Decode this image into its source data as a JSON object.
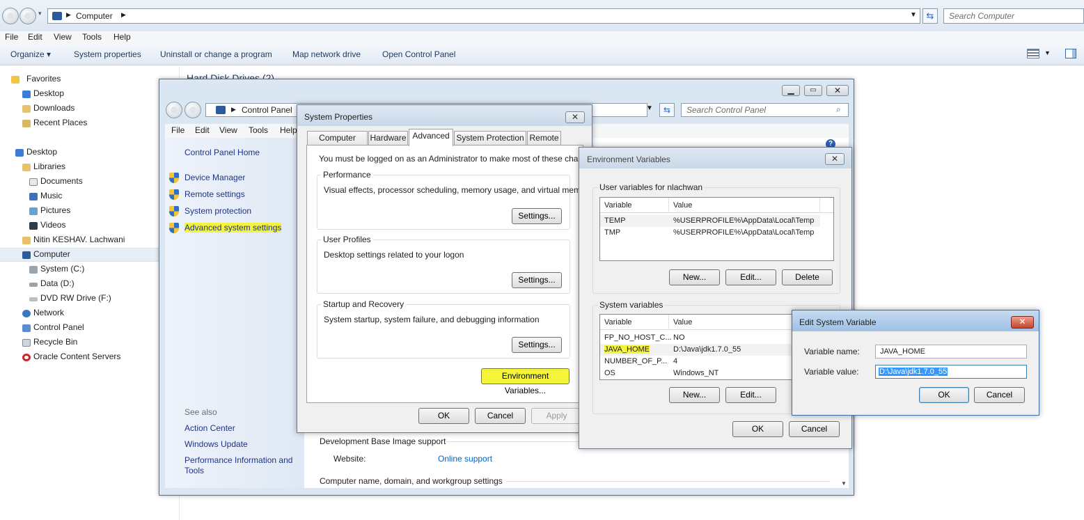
{
  "explorer": {
    "address": "Computer",
    "search_placeholder": "Search Computer",
    "menu": [
      "File",
      "Edit",
      "View",
      "Tools",
      "Help"
    ],
    "toolbar": [
      "Organize ▾",
      "System properties",
      "Uninstall or change a program",
      "Map network drive",
      "Open Control Panel"
    ],
    "section_header": "Hard Disk Drives (2)",
    "nav": {
      "favorites": "Favorites",
      "desktop_fav": "Desktop",
      "downloads": "Downloads",
      "recent_places": "Recent Places",
      "desktop": "Desktop",
      "libraries": "Libraries",
      "documents": "Documents",
      "music": "Music",
      "pictures": "Pictures",
      "videos": "Videos",
      "user": "Nitin KESHAV. Lachwani",
      "computer": "Computer",
      "system_c": "System (C:)",
      "data_d": "Data (D:)",
      "dvd_f": "DVD RW Drive (F:)",
      "network": "Network",
      "control_panel": "Control Panel",
      "recycle_bin": "Recycle Bin",
      "oracle": "Oracle Content Servers"
    }
  },
  "control_panel": {
    "address": "Control Panel",
    "search_placeholder": "Search Control Panel",
    "menu": [
      "File",
      "Edit",
      "View",
      "Tools",
      "Help"
    ],
    "home": "Control Panel Home",
    "links": [
      "Device Manager",
      "Remote settings",
      "System protection",
      "Advanced system settings"
    ],
    "see_also": "See also",
    "see_also_links": [
      "Action Center",
      "Windows Update",
      "Performance Information and",
      "Tools"
    ],
    "dev_support": "Development Base Image support",
    "website_label": "Website:",
    "website_link": "Online support",
    "computer_name_section": "Computer name, domain, and workgroup settings"
  },
  "system_properties": {
    "title": "System Properties",
    "tabs": [
      "Computer Name",
      "Hardware",
      "Advanced",
      "System Protection",
      "Remote"
    ],
    "active_tab": "Advanced",
    "admin_note": "You must be logged on as an Administrator to make most of these changes.",
    "performance": {
      "title": "Performance",
      "desc": "Visual effects, processor scheduling, memory usage, and virtual memory",
      "button": "Settings..."
    },
    "user_profiles": {
      "title": "User Profiles",
      "desc": "Desktop settings related to your logon",
      "button": "Settings..."
    },
    "startup": {
      "title": "Startup and Recovery",
      "desc": "System startup, system failure, and debugging information",
      "button": "Settings..."
    },
    "env_button": "Environment Variables...",
    "ok": "OK",
    "cancel": "Cancel",
    "apply": "Apply"
  },
  "env_vars": {
    "title": "Environment Variables",
    "user_group": "User variables for nlachwan",
    "col_variable": "Variable",
    "col_value": "Value",
    "user_rows": [
      {
        "var": "TEMP",
        "val": "%USERPROFILE%\\AppData\\Local\\Temp"
      },
      {
        "var": "TMP",
        "val": "%USERPROFILE%\\AppData\\Local\\Temp"
      }
    ],
    "sys_group": "System variables",
    "sys_rows": [
      {
        "var": "FP_NO_HOST_C...",
        "val": "NO"
      },
      {
        "var": "JAVA_HOME",
        "val": "D:\\Java\\jdk1.7.0_55"
      },
      {
        "var": "NUMBER_OF_P...",
        "val": "4"
      },
      {
        "var": "OS",
        "val": "Windows_NT"
      }
    ],
    "new": "New...",
    "edit": "Edit...",
    "delete": "Delete",
    "ok": "OK",
    "cancel": "Cancel"
  },
  "edit_var": {
    "title": "Edit System Variable",
    "name_label": "Variable name:",
    "name_value": "JAVA_HOME",
    "value_label": "Variable value:",
    "value_value": "D:\\Java\\jdk1.7.0_55",
    "ok": "OK",
    "cancel": "Cancel"
  },
  "colors": {
    "highlight": "#f4f43a",
    "link": "#1e3287",
    "selection": "#3399ff"
  }
}
